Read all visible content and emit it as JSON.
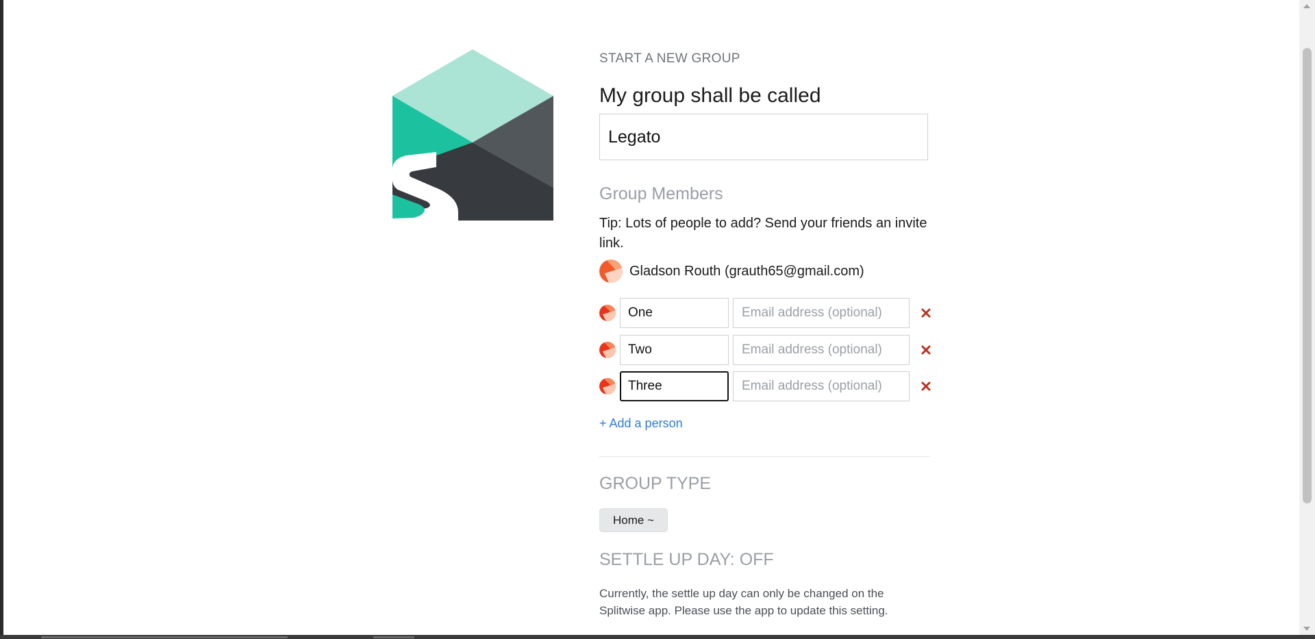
{
  "header": {
    "eyebrow": "START A NEW GROUP",
    "title": "My group shall be called"
  },
  "group": {
    "name": "Legato"
  },
  "members_section": {
    "label": "Group Members",
    "tip": "Tip: Lots of people to add? Send your friends an invite link.",
    "owner": "Gladson Routh (grauth65@gmail.com)",
    "email_placeholder": "Email address (optional)",
    "members": [
      {
        "name": "One",
        "email": ""
      },
      {
        "name": "Two",
        "email": ""
      },
      {
        "name": "Three",
        "email": ""
      }
    ],
    "add_person_label": "+ Add a person"
  },
  "group_type": {
    "label": "GROUP TYPE",
    "selected": "Home ~"
  },
  "settle_up": {
    "label": "SETTLE UP DAY: OFF",
    "note": "Currently, the settle up day can only be changed on the Splitwise app. Please use the app to update this setting."
  },
  "colors": {
    "logo_light": "#abe3d4",
    "logo_teal": "#1cc29f",
    "logo_gray": "#52575c",
    "logo_dark": "#373b3f",
    "link": "#2f7bd8",
    "remove": "#b5331f"
  }
}
